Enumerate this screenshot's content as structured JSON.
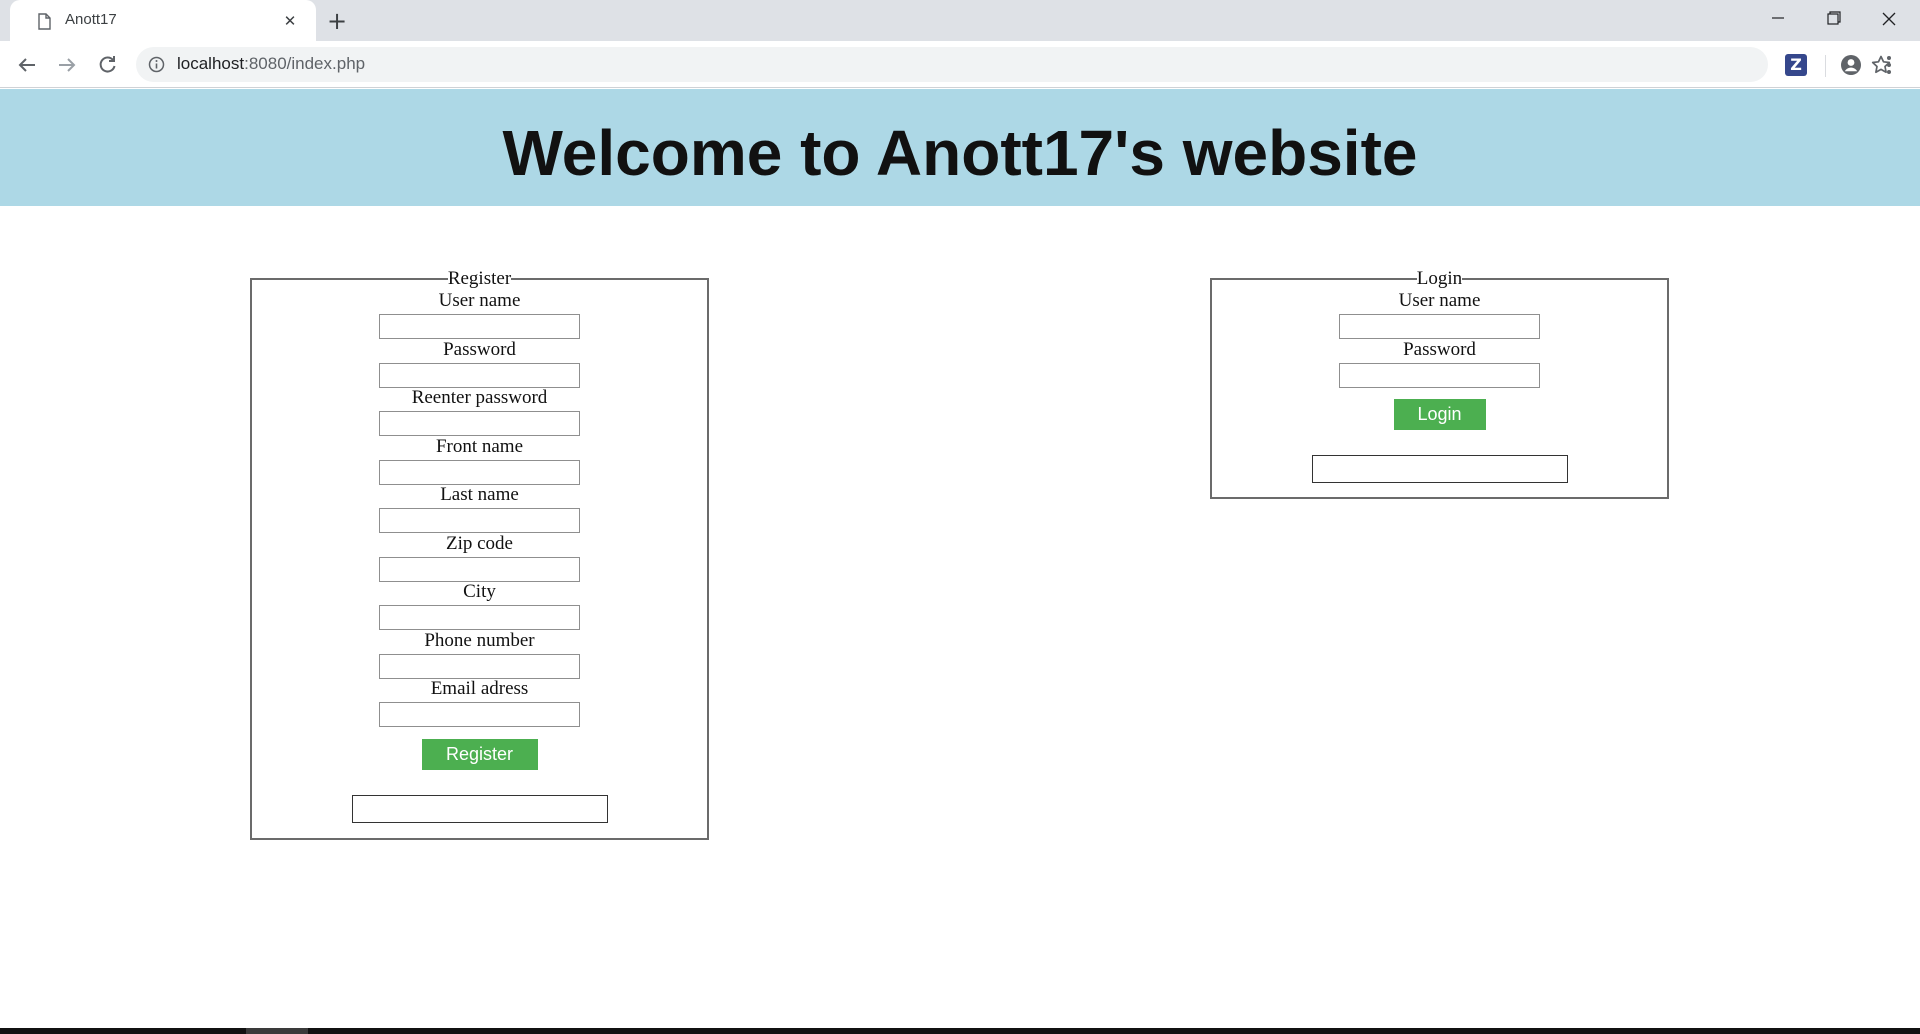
{
  "browser": {
    "tab_title": "Anott17",
    "url_host": "localhost",
    "url_path": ":8080/index.php",
    "extension_label": "Z",
    "icons": {
      "tab_favicon": "page-icon",
      "tab_close": "close-icon",
      "new_tab": "plus-icon",
      "back": "arrow-left-icon",
      "forward": "arrow-right-icon",
      "reload": "reload-icon",
      "site_info": "info-icon",
      "bookmark": "star-icon",
      "profile": "profile-icon",
      "menu": "kebab-menu-icon"
    }
  },
  "page": {
    "header_title": "Welcome to Anott17's website",
    "header_color": "#add8e6",
    "button_color": "#4caf50"
  },
  "register": {
    "legend": "Register",
    "fields": [
      {
        "label": "User name",
        "value": ""
      },
      {
        "label": "Password",
        "value": ""
      },
      {
        "label": "Reenter password",
        "value": ""
      },
      {
        "label": "Front name",
        "value": ""
      },
      {
        "label": "Last name",
        "value": ""
      },
      {
        "label": "Zip code",
        "value": ""
      },
      {
        "label": "City",
        "value": ""
      },
      {
        "label": "Phone number",
        "value": ""
      },
      {
        "label": "Email adress",
        "value": ""
      }
    ],
    "button_label": "Register",
    "message": ""
  },
  "login": {
    "legend": "Login",
    "fields": [
      {
        "label": "User name",
        "value": ""
      },
      {
        "label": "Password",
        "value": ""
      }
    ],
    "button_label": "Login",
    "message": ""
  }
}
